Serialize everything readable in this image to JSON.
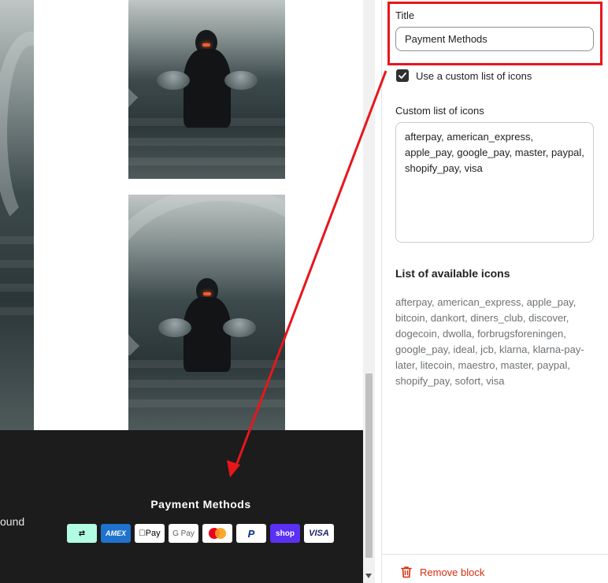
{
  "preview": {
    "footer_left_text": "ound",
    "footer_title": "Payment Methods",
    "payment_icons": [
      {
        "name": "afterpay",
        "label": "⇄",
        "bg": "#b2fce4",
        "fg": "#000000"
      },
      {
        "name": "american_express",
        "label": "AMEX",
        "bg": "#1f72cd",
        "fg": "#ffffff"
      },
      {
        "name": "apple_pay",
        "label": "Pay",
        "bg": "#ffffff",
        "fg": "#000000"
      },
      {
        "name": "google_pay",
        "label": "G Pay",
        "bg": "#ffffff",
        "fg": "#5f6368"
      },
      {
        "name": "master",
        "label": "",
        "bg": "#ffffff",
        "fg": "#000000"
      },
      {
        "name": "paypal",
        "label": "P",
        "bg": "#ffffff",
        "fg": "#003087"
      },
      {
        "name": "shopify_pay",
        "label": "shop",
        "bg": "#5a31f4",
        "fg": "#ffffff"
      },
      {
        "name": "visa",
        "label": "VISA",
        "bg": "#ffffff",
        "fg": "#1a1f71"
      }
    ]
  },
  "panel": {
    "title_label": "Title",
    "title_value": "Payment Methods",
    "checkbox_label": "Use a custom list of icons",
    "checkbox_checked": true,
    "custom_list_label": "Custom list of icons",
    "custom_list_value": "afterpay, american_express, apple_pay, google_pay, master, paypal, shopify_pay, visa",
    "available_heading": "List of available icons",
    "available_icons": "afterpay, american_express, apple_pay, bitcoin, dankort, diners_club, discover, dogecoin, dwolla, forbrugsforeningen, google_pay, ideal, jcb, klarna, klarna-pay-later, litecoin, maestro, master, paypal, shopify_pay, sofort, visa",
    "remove_label": "Remove block"
  },
  "colors": {
    "highlight": "#e8161b",
    "remove": "#d72c0d",
    "footer_bg": "#1c1c1c"
  }
}
